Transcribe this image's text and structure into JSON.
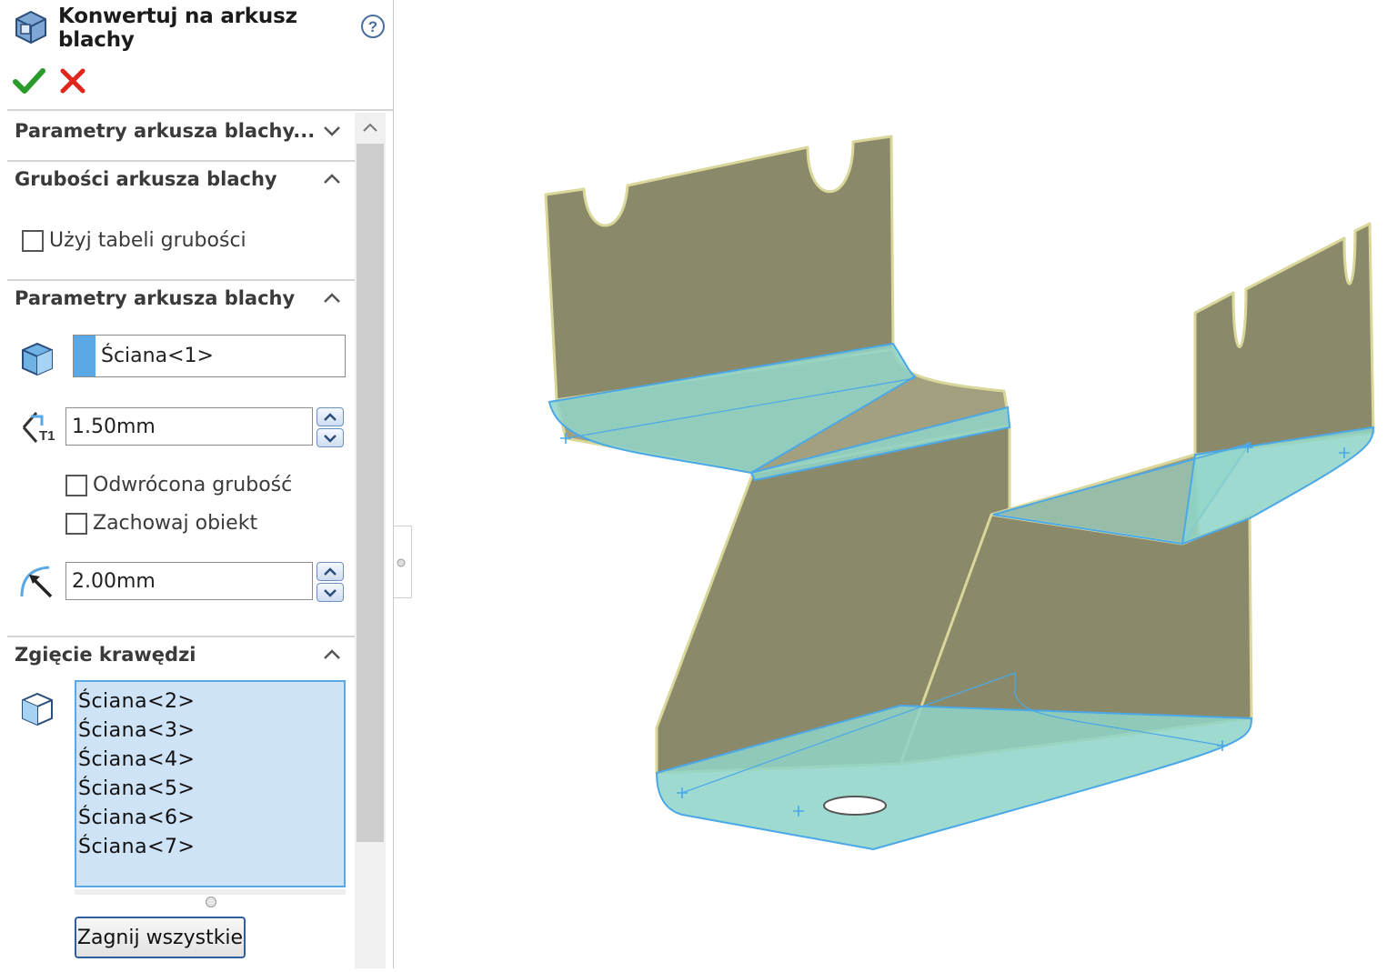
{
  "header": {
    "title": "Konwertuj na arkusz blachy",
    "icons": [
      "sheet-metal-feature-icon",
      "help-icon"
    ]
  },
  "actions": {
    "ok": "checkmark-icon",
    "cancel": "cross-icon",
    "ok_color": "#2a9a2a",
    "cancel_color": "#e0261b"
  },
  "sections": {
    "collapsed": {
      "title": "Parametry arkusza blachy..."
    },
    "gauges": {
      "title": "Grubości arkusza blachy",
      "use_gauge_table": {
        "label": "Użyj tabeli grubości",
        "checked": false
      }
    },
    "params": {
      "title": "Parametry arkusza blachy",
      "fixed_face": {
        "value": "Ściana<1>"
      },
      "thickness": {
        "value": "1.50mm"
      },
      "reverse_thickness": {
        "label": "Odwrócona grubość",
        "checked": false
      },
      "keep_body": {
        "label": "Zachowaj obiekt",
        "checked": false
      },
      "bend_radius": {
        "value": "2.00mm"
      }
    },
    "bend_edges": {
      "title": "Zgięcie krawędzi",
      "items": [
        "Ściana<2>",
        "Ściana<3>",
        "Ściana<4>",
        "Ściana<5>",
        "Ściana<6>",
        "Ściana<7>"
      ],
      "collect_all_button": "Zagnij wszystkie"
    }
  },
  "colors": {
    "selection_accent": "#5aa9e6",
    "list_background": "#cfe3f7",
    "part_face": "#8a8a6a",
    "bend_highlight": "#8ed4c8"
  }
}
